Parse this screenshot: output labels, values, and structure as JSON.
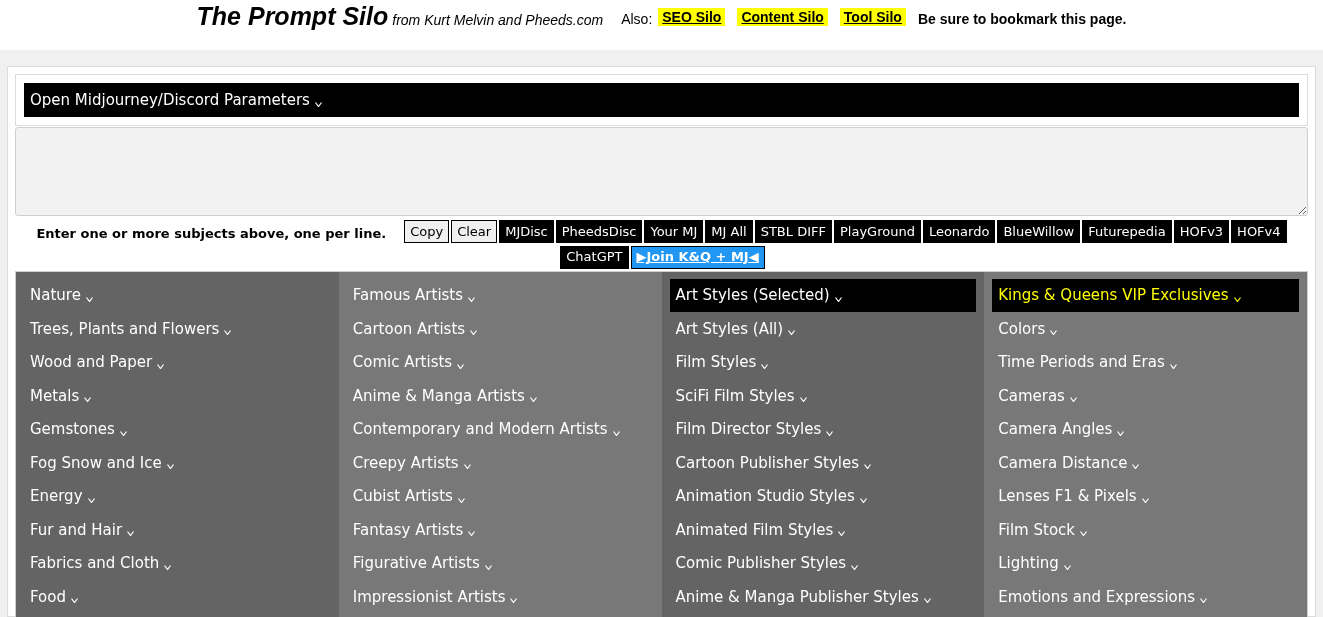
{
  "header": {
    "title": "The Prompt Silo",
    "byline": "from Kurt Melvin and Pheeds.com",
    "also_label": "Also:",
    "links": [
      "SEO Silo",
      "Content Silo",
      "Tool Silo"
    ],
    "note": "Be sure to bookmark this page."
  },
  "parameters_bar": {
    "label": "Open Midjourney/Discord Parameters"
  },
  "subjects": {
    "instruction": "Enter one or more subjects above, one per line.",
    "buttons": [
      {
        "label": "Copy",
        "kind": "plain"
      },
      {
        "label": "Clear",
        "kind": "plain"
      },
      {
        "label": "MJDisc",
        "kind": "dark"
      },
      {
        "label": "PheedsDisc",
        "kind": "dark"
      },
      {
        "label": "Your MJ",
        "kind": "dark"
      },
      {
        "label": "MJ All",
        "kind": "dark"
      },
      {
        "label": "STBL DIFF",
        "kind": "dark"
      },
      {
        "label": "PlayGround",
        "kind": "dark"
      },
      {
        "label": "Leonardo",
        "kind": "dark"
      },
      {
        "label": "BlueWillow",
        "kind": "dark"
      },
      {
        "label": "Futurepedia",
        "kind": "dark"
      },
      {
        "label": "HOFv3",
        "kind": "dark"
      },
      {
        "label": "HOFv4",
        "kind": "dark"
      },
      {
        "label": "ChatGPT",
        "kind": "dark"
      },
      {
        "label": "▶Join K&Q + MJ◀",
        "kind": "promo"
      }
    ]
  },
  "columns": [
    {
      "items": [
        {
          "label": "Nature",
          "kind": "normal"
        },
        {
          "label": "Trees, Plants and Flowers",
          "kind": "normal"
        },
        {
          "label": "Wood and Paper",
          "kind": "normal"
        },
        {
          "label": "Metals",
          "kind": "normal"
        },
        {
          "label": "Gemstones",
          "kind": "normal"
        },
        {
          "label": "Fog Snow and Ice",
          "kind": "normal"
        },
        {
          "label": "Energy",
          "kind": "normal"
        },
        {
          "label": "Fur and Hair",
          "kind": "normal"
        },
        {
          "label": "Fabrics and Cloth",
          "kind": "normal"
        },
        {
          "label": "Food",
          "kind": "normal"
        }
      ]
    },
    {
      "items": [
        {
          "label": "Famous Artists",
          "kind": "normal"
        },
        {
          "label": "Cartoon Artists",
          "kind": "normal"
        },
        {
          "label": "Comic Artists",
          "kind": "normal"
        },
        {
          "label": "Anime & Manga Artists",
          "kind": "normal"
        },
        {
          "label": "Contemporary and Modern Artists",
          "kind": "normal"
        },
        {
          "label": "Creepy Artists",
          "kind": "normal"
        },
        {
          "label": "Cubist Artists",
          "kind": "normal"
        },
        {
          "label": "Fantasy Artists",
          "kind": "normal"
        },
        {
          "label": "Figurative Artists",
          "kind": "normal"
        },
        {
          "label": "Impressionist Artists",
          "kind": "normal"
        }
      ]
    },
    {
      "items": [
        {
          "label": "Art Styles (Selected)",
          "kind": "selected"
        },
        {
          "label": "Art Styles (All)",
          "kind": "normal"
        },
        {
          "label": "Film Styles",
          "kind": "normal"
        },
        {
          "label": "SciFi Film Styles",
          "kind": "normal"
        },
        {
          "label": "Film Director Styles",
          "kind": "normal"
        },
        {
          "label": "Cartoon Publisher Styles",
          "kind": "normal"
        },
        {
          "label": "Animation Studio Styles",
          "kind": "normal"
        },
        {
          "label": "Animated Film Styles",
          "kind": "normal"
        },
        {
          "label": "Comic Publisher Styles",
          "kind": "normal"
        },
        {
          "label": "Anime & Manga Publisher Styles",
          "kind": "normal"
        }
      ]
    },
    {
      "items": [
        {
          "label": "Kings & Queens VIP Exclusives",
          "kind": "vip"
        },
        {
          "label": "Colors",
          "kind": "normal"
        },
        {
          "label": "Time Periods and Eras",
          "kind": "normal"
        },
        {
          "label": "Cameras",
          "kind": "normal"
        },
        {
          "label": "Camera Angles",
          "kind": "normal"
        },
        {
          "label": "Camera Distance",
          "kind": "normal"
        },
        {
          "label": "Lenses F1 & Pixels",
          "kind": "normal"
        },
        {
          "label": "Film Stock",
          "kind": "normal"
        },
        {
          "label": "Lighting",
          "kind": "normal"
        },
        {
          "label": "Emotions and Expressions",
          "kind": "normal"
        }
      ]
    }
  ]
}
